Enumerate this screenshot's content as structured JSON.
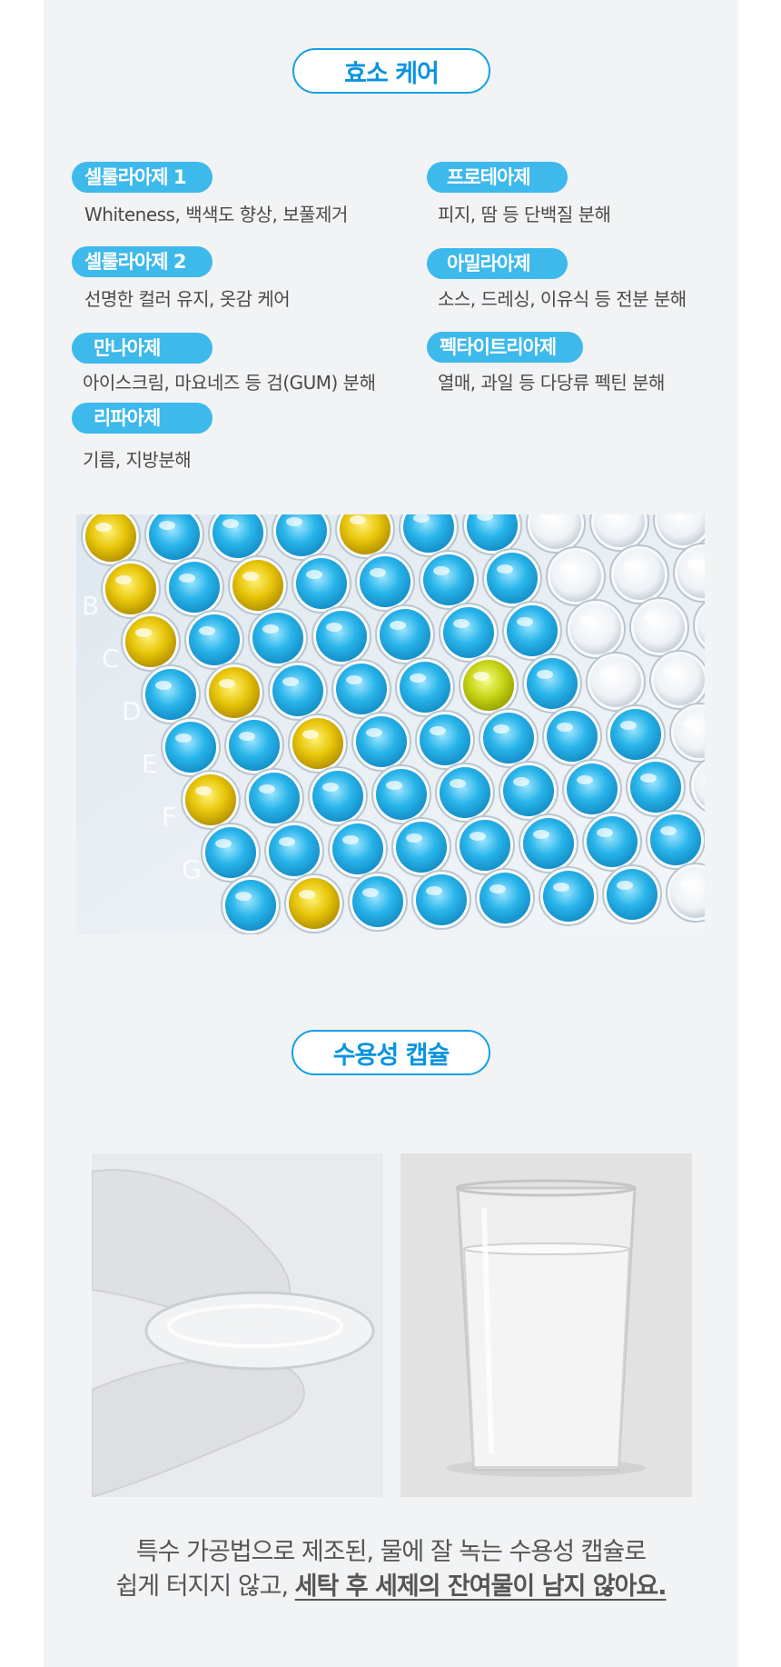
{
  "section1": {
    "title": "효소 케어",
    "enzymes": [
      {
        "name": "셀룰라아제 1",
        "desc": "Whiteness, 백색도 향상, 보풀제거"
      },
      {
        "name": "프로테아제",
        "desc": "피지, 땀 등 단백질 분해"
      },
      {
        "name": "셀룰라아제 2",
        "desc": "선명한 컬러 유지, 옷감 케어"
      },
      {
        "name": "아밀라아제",
        "desc": "소스, 드레싱, 이유식 등 전분 분해"
      },
      {
        "name": "만나아제",
        "desc": "아이스크림, 마요네즈 등 검(GUM) 분해"
      },
      {
        "name": "펙타이트리아제",
        "desc": "열매, 과일 등 다당류 펙틴 분해"
      },
      {
        "name": "리파아제",
        "desc": "기름, 지방분해"
      }
    ]
  },
  "plate_labels": [
    "B",
    "C",
    "D",
    "E",
    "F",
    "G"
  ],
  "section2": {
    "title": "수용성 캡슐",
    "caption_line1": "특수 가공법으로 제조된, 물에 잘 녹는 수용성 캡슐로",
    "caption_line2_prefix": "쉽게 터지지 않고, ",
    "caption_line2_strong": "세탁 후 세제의 잔여물이 남지 않아요."
  },
  "colors": {
    "accent": "#12a0e8",
    "tag_bg": "#3db9ec",
    "panel_bg": "#f1f3f5"
  }
}
